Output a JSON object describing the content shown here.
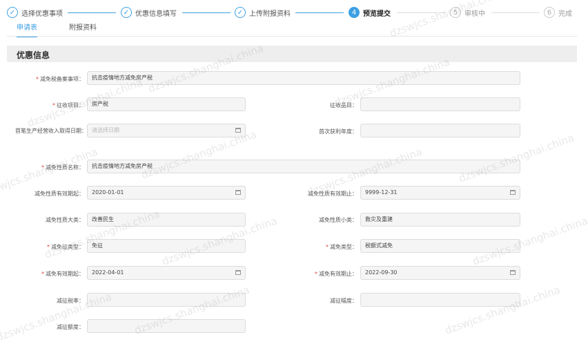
{
  "steps": [
    {
      "number": "1",
      "label": "选择优惠事项",
      "status": "done"
    },
    {
      "number": "2",
      "label": "优惠信息填写",
      "status": "done"
    },
    {
      "number": "3",
      "label": "上传附报资料",
      "status": "done"
    },
    {
      "number": "4",
      "label": "预览提交",
      "status": "active"
    },
    {
      "number": "5",
      "label": "审核中",
      "status": "todo"
    },
    {
      "number": "6",
      "label": "完成",
      "status": "todo"
    }
  ],
  "tabs": [
    {
      "label": "申请表",
      "active": true
    },
    {
      "label": "附报资料",
      "active": false
    }
  ],
  "section": {
    "title": "优惠信息"
  },
  "form": {
    "jmsbsx": {
      "label": "减免税备案事项：",
      "value": "抗击疫情地方减免房产税"
    },
    "zsxm": {
      "label": "征收项目：",
      "value": "房产税"
    },
    "zspm": {
      "label": "征收品目：",
      "value": ""
    },
    "scrq": {
      "label": "首笔生产经营收入取得日期：",
      "value": "",
      "placeholder": "请选择日期"
    },
    "schlnd": {
      "label": "首次获利年度：",
      "value": ""
    },
    "jmxzmc": {
      "label": "减免性质名称：",
      "value": "抗击疫情地方减免房产税"
    },
    "xzyxqq": {
      "label": "减免性质有效期起：",
      "value": "2020-01-01"
    },
    "xzyxqz": {
      "label": "减免性质有效期止：",
      "value": "9999-12-31"
    },
    "xzdl": {
      "label": "减免性质大类：",
      "value": "改善民生"
    },
    "xzxl": {
      "label": "减免性质小类：",
      "value": "救灾及重建"
    },
    "jzlx": {
      "label": "减免征类型：",
      "value": "免征"
    },
    "jmlx": {
      "label": "减免类型：",
      "value": "税额式减免"
    },
    "yxqq": {
      "label": "减免有效期起：",
      "value": "2022-04-01"
    },
    "yxqz": {
      "label": "减免有效期止：",
      "value": "2022-09-30"
    },
    "jzsl": {
      "label": "减征税率：",
      "value": ""
    },
    "jzfd": {
      "label": "减征幅度：",
      "value": ""
    },
    "jzed": {
      "label": "减征额度：",
      "value": ""
    }
  },
  "colors": {
    "accent": "#3da0e3",
    "required": "#e0453a"
  },
  "watermark": "dzswjcs.shanghai.china"
}
